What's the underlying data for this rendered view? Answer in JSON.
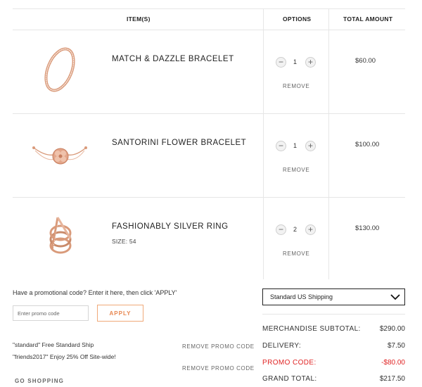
{
  "table": {
    "headers": {
      "items": "ITEM(S)",
      "options": "OPTIONS",
      "total": "TOTAL AMOUNT"
    }
  },
  "items": [
    {
      "name": "MATCH & DAZZLE BRACELET",
      "size": "",
      "qty": "1",
      "remove": "REMOVE",
      "price": "$60.00",
      "image_icon": "bangle-bracelet-image"
    },
    {
      "name": "SANTORINI FLOWER BRACELET",
      "size": "",
      "qty": "1",
      "remove": "REMOVE",
      "price": "$100.00",
      "image_icon": "flower-bracelet-image"
    },
    {
      "name": "FASHIONABLY SILVER RING",
      "size": "SIZE: 54",
      "qty": "2",
      "remove": "REMOVE",
      "price": "$130.00",
      "image_icon": "stacked-ring-image"
    }
  ],
  "qty_controls": {
    "minus": "−",
    "plus": "+"
  },
  "promo": {
    "question": "Have a promotional code? Enter it here, then click 'APPLY'",
    "placeholder": "Enter promo code",
    "apply_label": "APPLY",
    "codes": [
      {
        "text": "\"standard\" Free Standard Ship",
        "remove": "REMOVE PROMO CODE"
      },
      {
        "text": "\"friends2017\" Enjoy 25% Off Site-wide!",
        "remove": "REMOVE PROMO CODE"
      }
    ],
    "go_shopping": "GO SHOPPING"
  },
  "shipping": {
    "selected": "Standard US Shipping"
  },
  "summary": {
    "subtotal_label": "MERCHANDISE SUBTOTAL:",
    "subtotal": "$290.00",
    "delivery_label": "DELIVERY:",
    "delivery": "$7.50",
    "promo_label": "PROMO CODE:",
    "promo": "-$80.00",
    "total_label": "GRAND TOTAL:",
    "total": "$217.50"
  },
  "colors": {
    "accent": "#e8864f",
    "promo_red": "#e02424",
    "rose_gold": "#d99a7a"
  }
}
